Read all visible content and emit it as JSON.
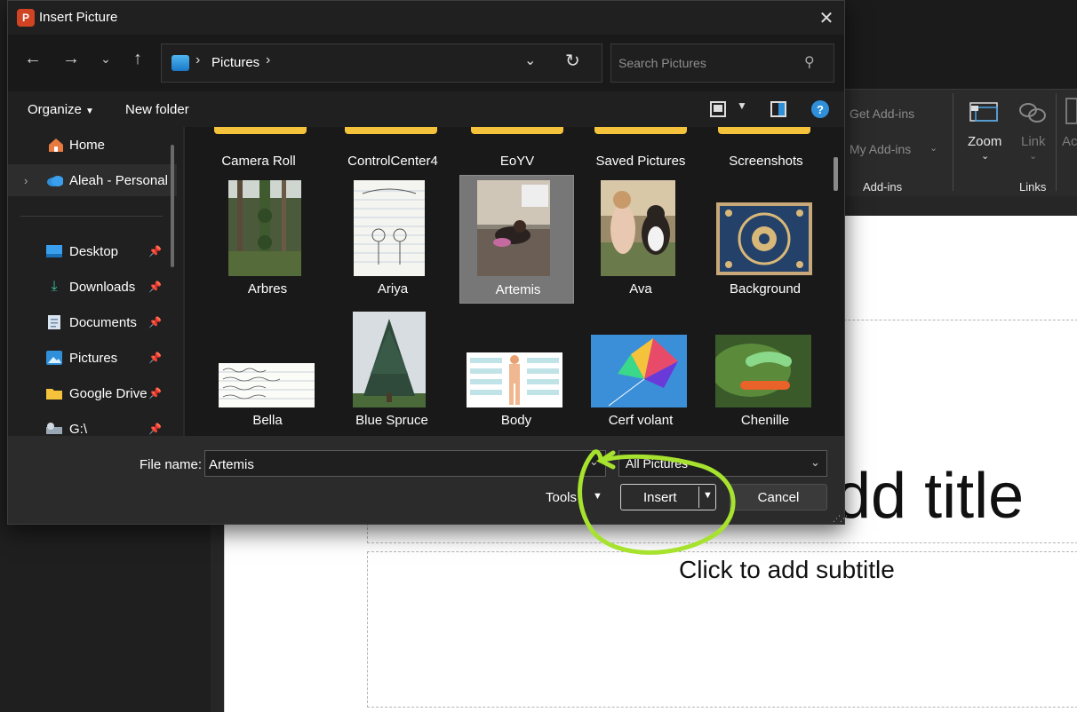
{
  "dialog": {
    "title": "Insert Picture",
    "app_icon_letter": "P"
  },
  "nav": {
    "address_folder": "Pictures",
    "search_placeholder": "Search Pictures"
  },
  "commands": {
    "organize": "Organize",
    "new_folder": "New folder",
    "help": "?"
  },
  "sidebar": {
    "items": [
      {
        "label": "Home",
        "icon": "home-icon"
      },
      {
        "label": "Aleah - Personal",
        "icon": "onedrive-cloud-icon"
      },
      {
        "label": "Desktop",
        "icon": "desktop-icon"
      },
      {
        "label": "Downloads",
        "icon": "download-arrow-icon"
      },
      {
        "label": "Documents",
        "icon": "documents-icon"
      },
      {
        "label": "Pictures",
        "icon": "pictures-icon"
      },
      {
        "label": "Google Drive",
        "icon": "folder-icon"
      },
      {
        "label": "G:\\",
        "icon": "drive-icon"
      }
    ]
  },
  "folders": [
    "Camera Roll",
    "ControlCenter4",
    "EoYV",
    "Saved Pictures",
    "Screenshots"
  ],
  "files": [
    "Arbres",
    "Ariya",
    "Artemis",
    "Ava",
    "Background",
    "Bella",
    "Blue Spruce",
    "Body",
    "Cerf volant",
    "Chenille"
  ],
  "bottom": {
    "filename_label": "File name:",
    "filename_value": "Artemis",
    "filetype": "All Pictures",
    "tools": "Tools",
    "insert": "Insert",
    "cancel": "Cancel"
  },
  "ribbon": {
    "get_addins": "Get Add-ins",
    "my_addins": "My Add-ins",
    "addins_group": "Add-ins",
    "zoom": "Zoom",
    "link": "Link",
    "links_group": "Links",
    "action": "Ac"
  },
  "slide": {
    "title_placeholder": "dd title",
    "subtitle_placeholder": "Click to add subtitle"
  },
  "colors": {
    "accent": "#2f8fd9",
    "annotation": "#a6e22e",
    "folder": "#f5c33b"
  }
}
